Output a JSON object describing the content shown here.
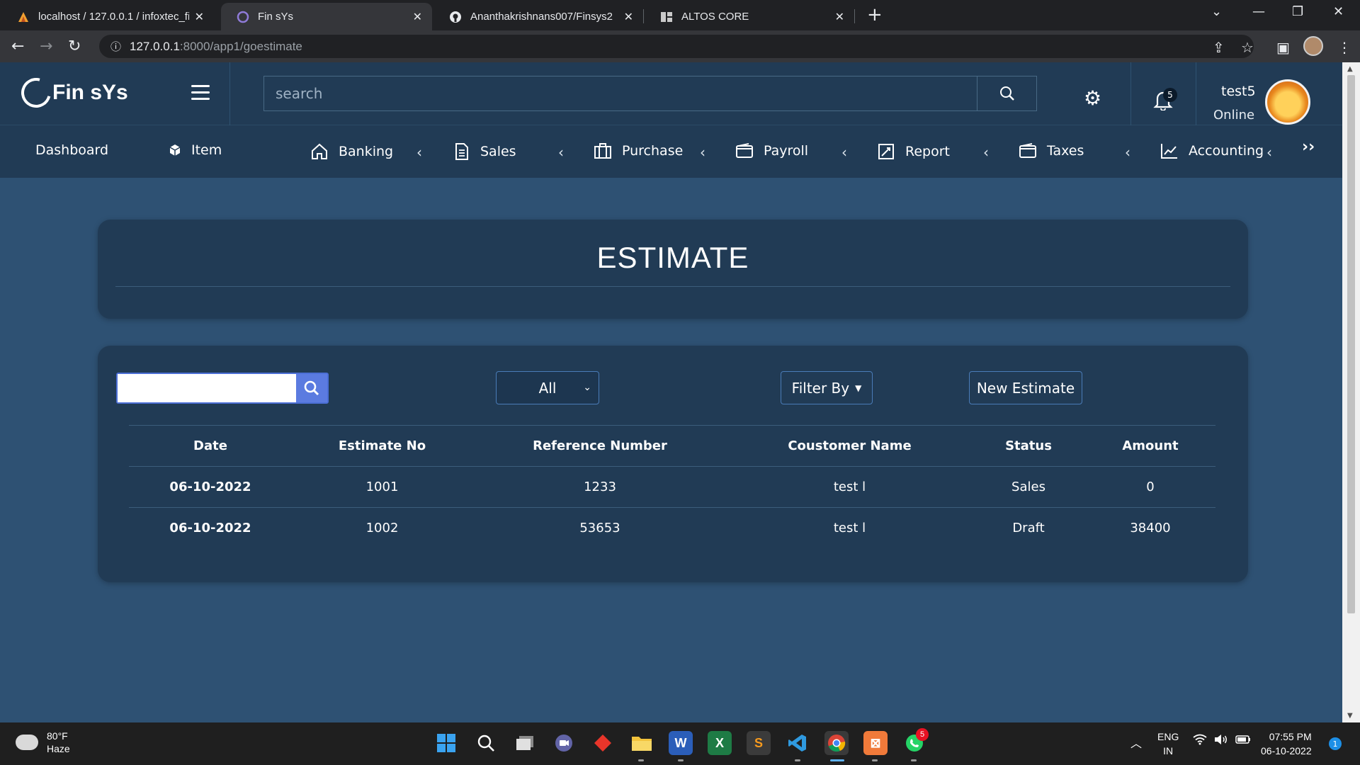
{
  "browser": {
    "tabs": [
      {
        "title": "localhost / 127.0.0.1 / infoxtec_fir"
      },
      {
        "title": "Fin sYs"
      },
      {
        "title": "Ananthakrishnans007/Finsys2"
      },
      {
        "title": "ALTOS CORE"
      }
    ],
    "url_host": "127.0.0.1",
    "url_path": ":8000/app1/goestimate"
  },
  "header": {
    "brand": "Fin sYs",
    "search_placeholder": "search",
    "notification_count": "5",
    "user_name": "test5",
    "user_status": "Online"
  },
  "nav": {
    "items": [
      {
        "label": "Dashboard",
        "icon": "none"
      },
      {
        "label": "Item",
        "icon": "cube-icon"
      },
      {
        "label": "Banking",
        "icon": "home-icon"
      },
      {
        "label": "Sales",
        "icon": "document-icon"
      },
      {
        "label": "Purchase",
        "icon": "briefcase-icon"
      },
      {
        "label": "Payroll",
        "icon": "wallet-icon"
      },
      {
        "label": "Report",
        "icon": "chart-box-icon"
      },
      {
        "label": "Taxes",
        "icon": "wallet-icon"
      },
      {
        "label": "Accounting",
        "icon": "line-chart-icon"
      }
    ],
    "more": "››"
  },
  "page": {
    "title": "ESTIMATE",
    "filter_select": "All",
    "filter_button": "Filter By",
    "new_button": "New Estimate"
  },
  "table": {
    "headers": [
      "Date",
      "Estimate No",
      "Reference Number",
      "Coustomer Name",
      "Status",
      "Amount"
    ],
    "rows": [
      [
        "06-10-2022",
        "1001",
        "1233",
        "test l",
        "Sales",
        "0"
      ],
      [
        "06-10-2022",
        "1002",
        "53653",
        "test l",
        "Draft",
        "38400"
      ]
    ]
  },
  "taskbar": {
    "temperature": "80°F",
    "weather": "Haze",
    "lang": "ENG",
    "region": "IN",
    "time": "07:55 PM",
    "date": "06-10-2022",
    "notification_count": "1",
    "whatsapp_badge": "5"
  },
  "colors": {
    "page_bg": "#2e5173",
    "panel_bg": "#213b55",
    "accent": "#5b7be0"
  }
}
